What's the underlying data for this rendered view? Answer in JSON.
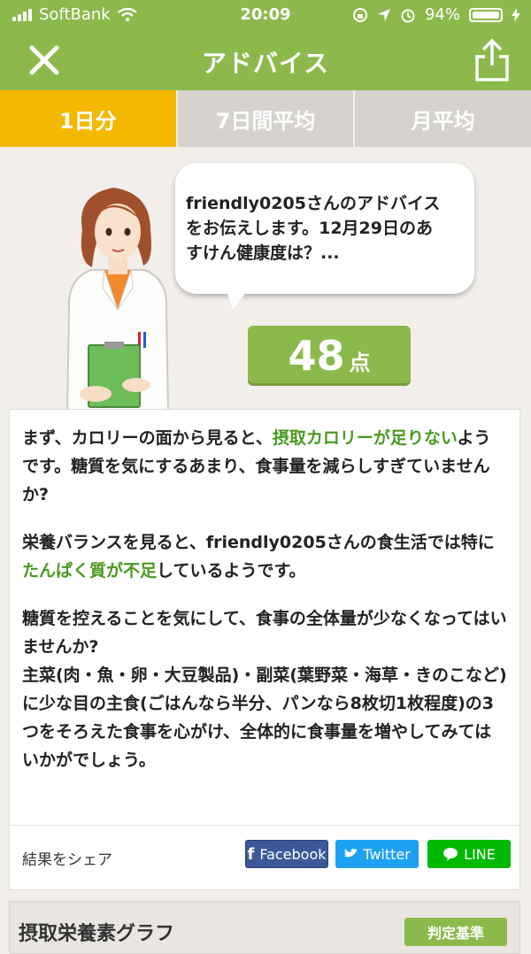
{
  "status_bar": {
    "carrier": "SoftBank",
    "time": "20:09",
    "battery": "94%"
  },
  "nav": {
    "title": "アドバイス",
    "close_icon": "close-icon",
    "share_icon": "share-icon"
  },
  "tabs": [
    {
      "label": "1日分",
      "active": true
    },
    {
      "label": "7日間平均",
      "active": false
    },
    {
      "label": "月平均",
      "active": false
    }
  ],
  "bubble": {
    "line1": "friendly0205さんのアドバイス",
    "line2": "をお伝えします。12月29日のあ",
    "line3": "すけん健康度は？..."
  },
  "score": {
    "value": "48",
    "unit": "点"
  },
  "advice": {
    "p1_a": "まず、カロリーの面から見ると、",
    "p1_hl": "摂取カロリーが足りない",
    "p1_b": "ようです。糖質を気にするあまり、食事量を減らしすぎていませんか?",
    "p2_a": "栄養バランスを見ると、friendly0205さんの食生活では特に",
    "p2_hl": "たんぱく質が不足",
    "p2_b": "しているようです。",
    "p3_a": "糖質を控えることを気にして、食事の全体量が少なくなってはいませんか?",
    "p3_b": "主菜(肉・魚・卵・大豆製品)・副菜(葉野菜・海草・きのこなど)に少な目の主食(ごはんなら半分、パンなら8枚切1枚程度)の3つをそろえた食事を心がけ、全体的に食事量を増やしてみてはいかがでしょう。"
  },
  "share": {
    "label": "結果をシェア",
    "facebook": "Facebook",
    "twitter": "Twitter",
    "line": "LINE"
  },
  "graph": {
    "title": "摂取栄養素グラフ",
    "criteria_button": "判定基準"
  },
  "colors": {
    "brand_green": "#8cb94c",
    "active_tab": "#f5b800",
    "highlight_text": "#4a9a21",
    "facebook": "#3b5998",
    "twitter": "#1da1f2",
    "line": "#00b900"
  }
}
